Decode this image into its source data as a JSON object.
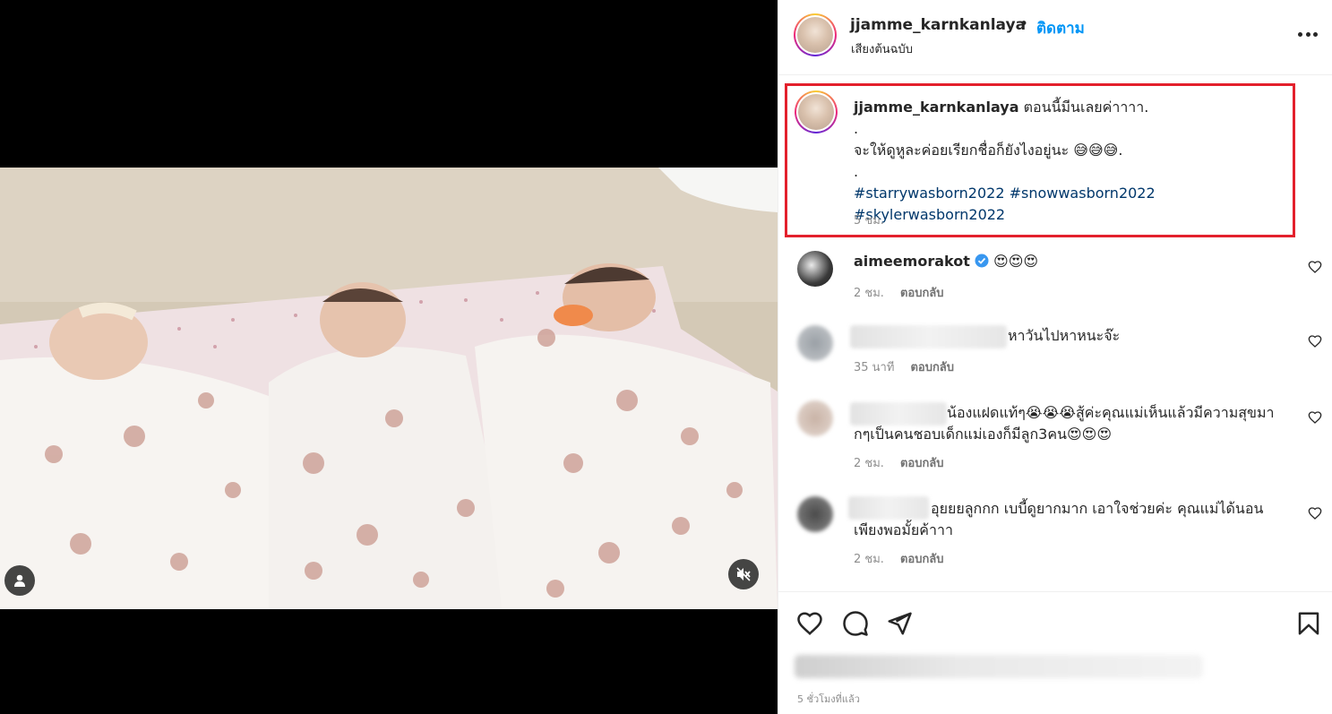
{
  "post": {
    "username": "jjamme_karnkanlaya",
    "separator": "•",
    "follow_label": "ติดตาม",
    "audio_label": "เสียงต้นฉบับ"
  },
  "caption": {
    "username": "jjamme_karnkanlaya",
    "line1": "ตอนนี้มีนเลยค่าาาา.",
    "line2": ".",
    "line3": "จะให้ดูหูละค่อยเรียกชื่อก็ยังไงอยู่นะ 😅😅😅.",
    "line4": ".",
    "hashtags": "#starrywasborn2022 #snowwasborn2022 #skylerwasborn2022",
    "time": "5 ชม."
  },
  "comments": [
    {
      "username": "aimeemorakot",
      "verified": true,
      "text": "😍😍😍",
      "time": "2 ชม.",
      "reply": "ตอบกลับ"
    },
    {
      "username": "",
      "text": "หาวันไปหาหนะจ๊ะ",
      "time": "35 นาที",
      "reply": "ตอบกลับ"
    },
    {
      "username": "",
      "text": "น้องแฝดแท้ๆ😭😭😭สู้ค่ะคุณแม่เห็นแล้วมีความสุขมากๆเป็นคนชอบเด็กแม่เองก็มีลูก3คน😍😍😍",
      "time": "2 ชม.",
      "reply": "ตอบกลับ"
    },
    {
      "username": "",
      "text": "อุยยยลูกกก เบบี้ดูยากมาก เอาใจช่วยค่ะ คุณแม่ได้นอนเพียงพอมั้ยค้าาา",
      "time": "2 ชม.",
      "reply": "ตอบกลับ"
    }
  ],
  "footer": {
    "time": "5 ชั่วโมงที่แล้ว"
  },
  "icons": {
    "like": "heart-icon",
    "comment": "comment-icon",
    "share": "share-icon",
    "save": "bookmark-icon",
    "more": "more-horizontal-icon",
    "mute": "muted-speaker-icon",
    "tag": "user-tag-icon"
  },
  "colors": {
    "accent": "#0095f6",
    "highlight": "#e3202c",
    "hashtag": "#00376b",
    "verified": "#3897f0"
  }
}
